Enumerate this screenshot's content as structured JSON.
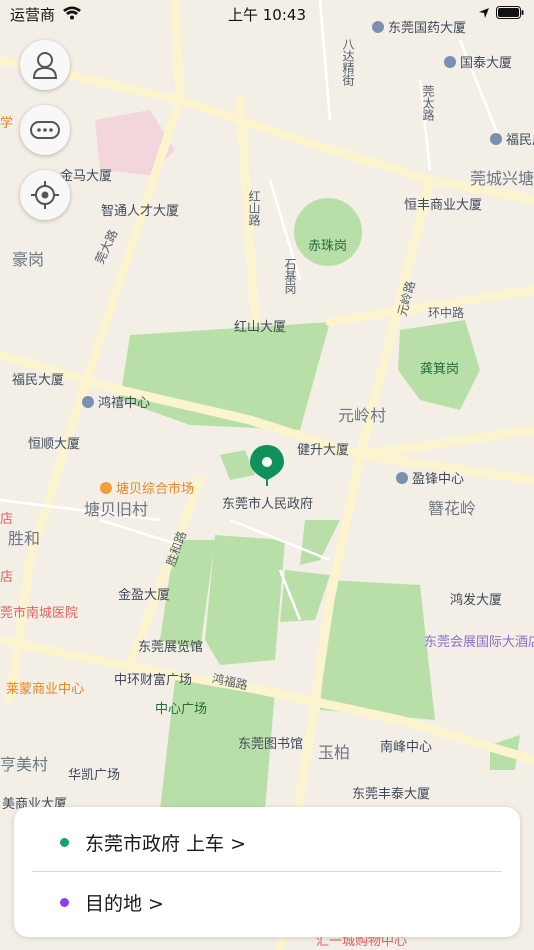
{
  "status_bar": {
    "carrier": "运营商",
    "time": "上午 10:43"
  },
  "colors": {
    "map_bg": "#f3efe6",
    "park": "#b9dfa8",
    "road": "#fbf4cf",
    "pin": "#10915b",
    "pickup_dot": "#18a06a",
    "dest_dot": "#8b3ff0"
  },
  "map": {
    "labels": [
      {
        "text": "东莞国药大厦",
        "poi": "b"
      },
      {
        "text": "国泰大厦",
        "poi": "b"
      },
      {
        "text": "福民广场",
        "poi": "b"
      },
      {
        "text": "莞城兴塘",
        "poi": ""
      },
      {
        "text": "金马大厦",
        "poi": "b"
      },
      {
        "text": "智通人才大厦",
        "poi": "b"
      },
      {
        "text": "恒丰商业大厦",
        "poi": "b"
      },
      {
        "text": "赤珠岗",
        "poi": "g"
      },
      {
        "text": "豪岗",
        "poi": ""
      },
      {
        "text": "红山大厦",
        "poi": "b"
      },
      {
        "text": "龚箕岗",
        "poi": "g"
      },
      {
        "text": "福民大厦",
        "poi": "b"
      },
      {
        "text": "鸿禧中心",
        "poi": "b"
      },
      {
        "text": "元岭村",
        "poi": ""
      },
      {
        "text": "恒顺大厦",
        "poi": "b"
      },
      {
        "text": "健升大厦",
        "poi": "b"
      },
      {
        "text": "塘贝综合市场",
        "poi": "o"
      },
      {
        "text": "东莞市人民政府",
        "poi": "b"
      },
      {
        "text": "盈锋中心",
        "poi": "b"
      },
      {
        "text": "塘贝旧村",
        "poi": ""
      },
      {
        "text": "簪花岭",
        "poi": ""
      },
      {
        "text": "胜和",
        "poi": ""
      },
      {
        "text": "店",
        "poi": ""
      },
      {
        "text": "金盈大厦",
        "poi": "b"
      },
      {
        "text": "鸿发大厦",
        "poi": "b"
      },
      {
        "text": "莞市南城医院",
        "poi": "r"
      },
      {
        "text": "东莞展览馆",
        "poi": "b"
      },
      {
        "text": "东莞会展国际大酒店",
        "poi": "p"
      },
      {
        "text": "中环财富广场",
        "poi": "b"
      },
      {
        "text": "莱蒙商业中心",
        "poi": "o"
      },
      {
        "text": "中心广场",
        "poi": "g"
      },
      {
        "text": "东莞图书馆",
        "poi": "b"
      },
      {
        "text": "玉柏",
        "poi": ""
      },
      {
        "text": "南峰中心",
        "poi": "b"
      },
      {
        "text": "亨美村",
        "poi": ""
      },
      {
        "text": "华凯广场",
        "poi": "b"
      },
      {
        "text": "美商业大厦",
        "poi": "b"
      },
      {
        "text": "东莞丰泰大厦",
        "poi": "b"
      },
      {
        "text": "汇一城购物中心",
        "poi": ""
      },
      {
        "text": "学",
        "poi": ""
      },
      {
        "text": "店",
        "poi": ""
      }
    ],
    "roads": [
      "八达精街",
      "莞大路",
      "红山路",
      "石基岗",
      "元岭路",
      "环中路",
      "胜和路",
      "鸿福路",
      "莞太路"
    ]
  },
  "trip": {
    "pickup_label": "东莞市政府 上车 >",
    "destination_label": "目的地 >"
  }
}
